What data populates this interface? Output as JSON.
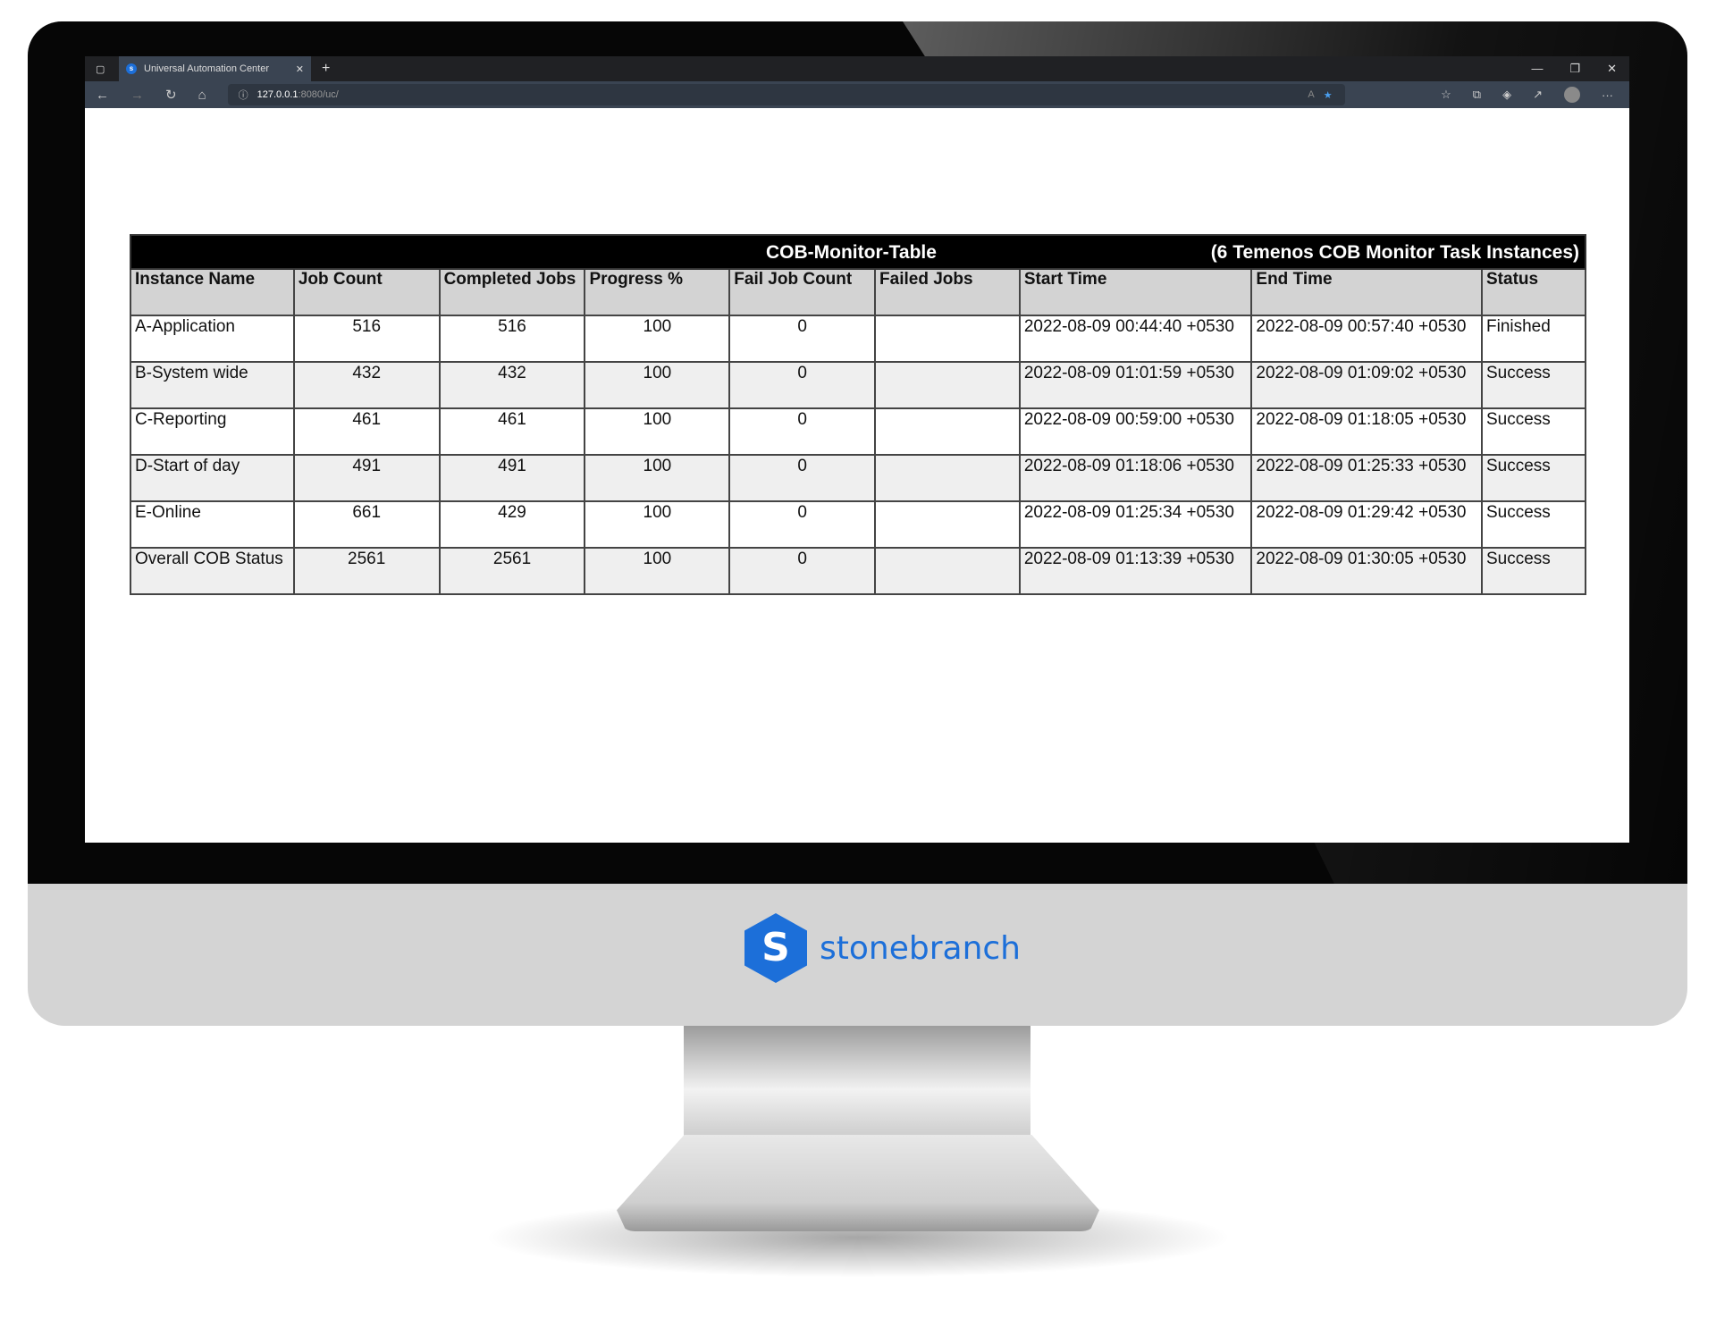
{
  "browser": {
    "tab_title": "Universal Automation Center",
    "url_host": "127.0.0.1",
    "url_path": ":8080/uc/"
  },
  "table": {
    "caption": "COB-Monitor-Table",
    "subcaption": "(6 Temenos COB Monitor Task Instances)",
    "columns": [
      "Instance Name",
      "Job Count",
      "Completed Jobs",
      "Progress %",
      "Fail Job Count",
      "Failed Jobs",
      "Start Time",
      "End Time",
      "Status"
    ],
    "rows": [
      [
        "A-Application",
        "516",
        "516",
        "100",
        "0",
        "",
        "2022-08-09 00:44:40 +0530",
        "2022-08-09 00:57:40 +0530",
        "Finished"
      ],
      [
        "B-System wide",
        "432",
        "432",
        "100",
        "0",
        "",
        "2022-08-09 01:01:59 +0530",
        "2022-08-09 01:09:02 +0530",
        "Success"
      ],
      [
        "C-Reporting",
        "461",
        "461",
        "100",
        "0",
        "",
        "2022-08-09 00:59:00 +0530",
        "2022-08-09 01:18:05 +0530",
        "Success"
      ],
      [
        "D-Start of day",
        "491",
        "491",
        "100",
        "0",
        "",
        "2022-08-09 01:18:06 +0530",
        "2022-08-09 01:25:33 +0530",
        "Success"
      ],
      [
        "E-Online",
        "661",
        "429",
        "100",
        "0",
        "",
        "2022-08-09 01:25:34 +0530",
        "2022-08-09 01:29:42 +0530",
        "Success"
      ],
      [
        "Overall COB Status",
        "2561",
        "2561",
        "100",
        "0",
        "",
        "2022-08-09 01:13:39 +0530",
        "2022-08-09 01:30:05 +0530",
        "Success"
      ]
    ]
  },
  "brand": {
    "name": "stonebranch",
    "letter": "S",
    "color": "#1c6fd9"
  }
}
